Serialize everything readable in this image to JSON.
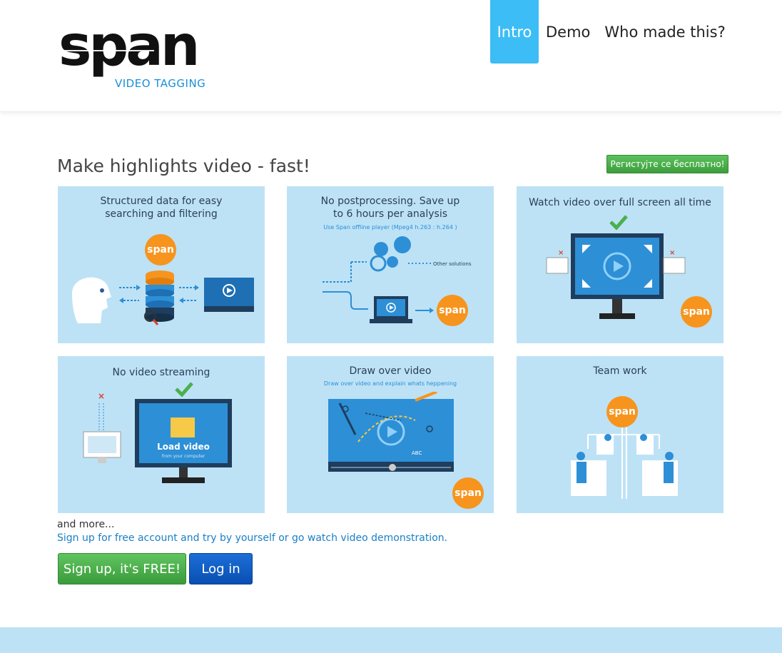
{
  "logo": {
    "word": "span",
    "subtitle": "VIDEO TAGGING"
  },
  "nav": {
    "intro": "Intro",
    "demo": "Demo",
    "who": "Who made this?"
  },
  "page": {
    "title": "Make highlights video - fast!",
    "register_btn": "Регистујте се бесплатно!",
    "more": "and more...",
    "signup_text": "Sign up for free account and try by yourself or go watch video demonstration.",
    "signup_btn": "Sign up, it's FREE!",
    "login_btn": "Log in"
  },
  "tiles": [
    {
      "title": "Structured data for easy searching and filtering",
      "badge": "span"
    },
    {
      "title": "No postprocessing. Save up to 6 hours per analysis",
      "subtitle": "Use Span offline player (Mpeg4 h.263 : h.264 )",
      "label": "Other solutions",
      "badge": "span"
    },
    {
      "title": "Watch video over full screen all time",
      "badge": "span"
    },
    {
      "title": "No video streaming",
      "load_title": "Load video",
      "load_sub": "from your computer"
    },
    {
      "title": "Draw over video",
      "subtitle": "Draw over video and explain whats heppening",
      "label": "ABC",
      "badge": "span"
    },
    {
      "title": "Team work",
      "badge": "span"
    }
  ],
  "colors": {
    "accent": "#3dbdf5",
    "tile_bg": "#bde2f6",
    "orange": "#f7941d",
    "green": "#4caf4c",
    "blue": "#0f5fc7"
  }
}
